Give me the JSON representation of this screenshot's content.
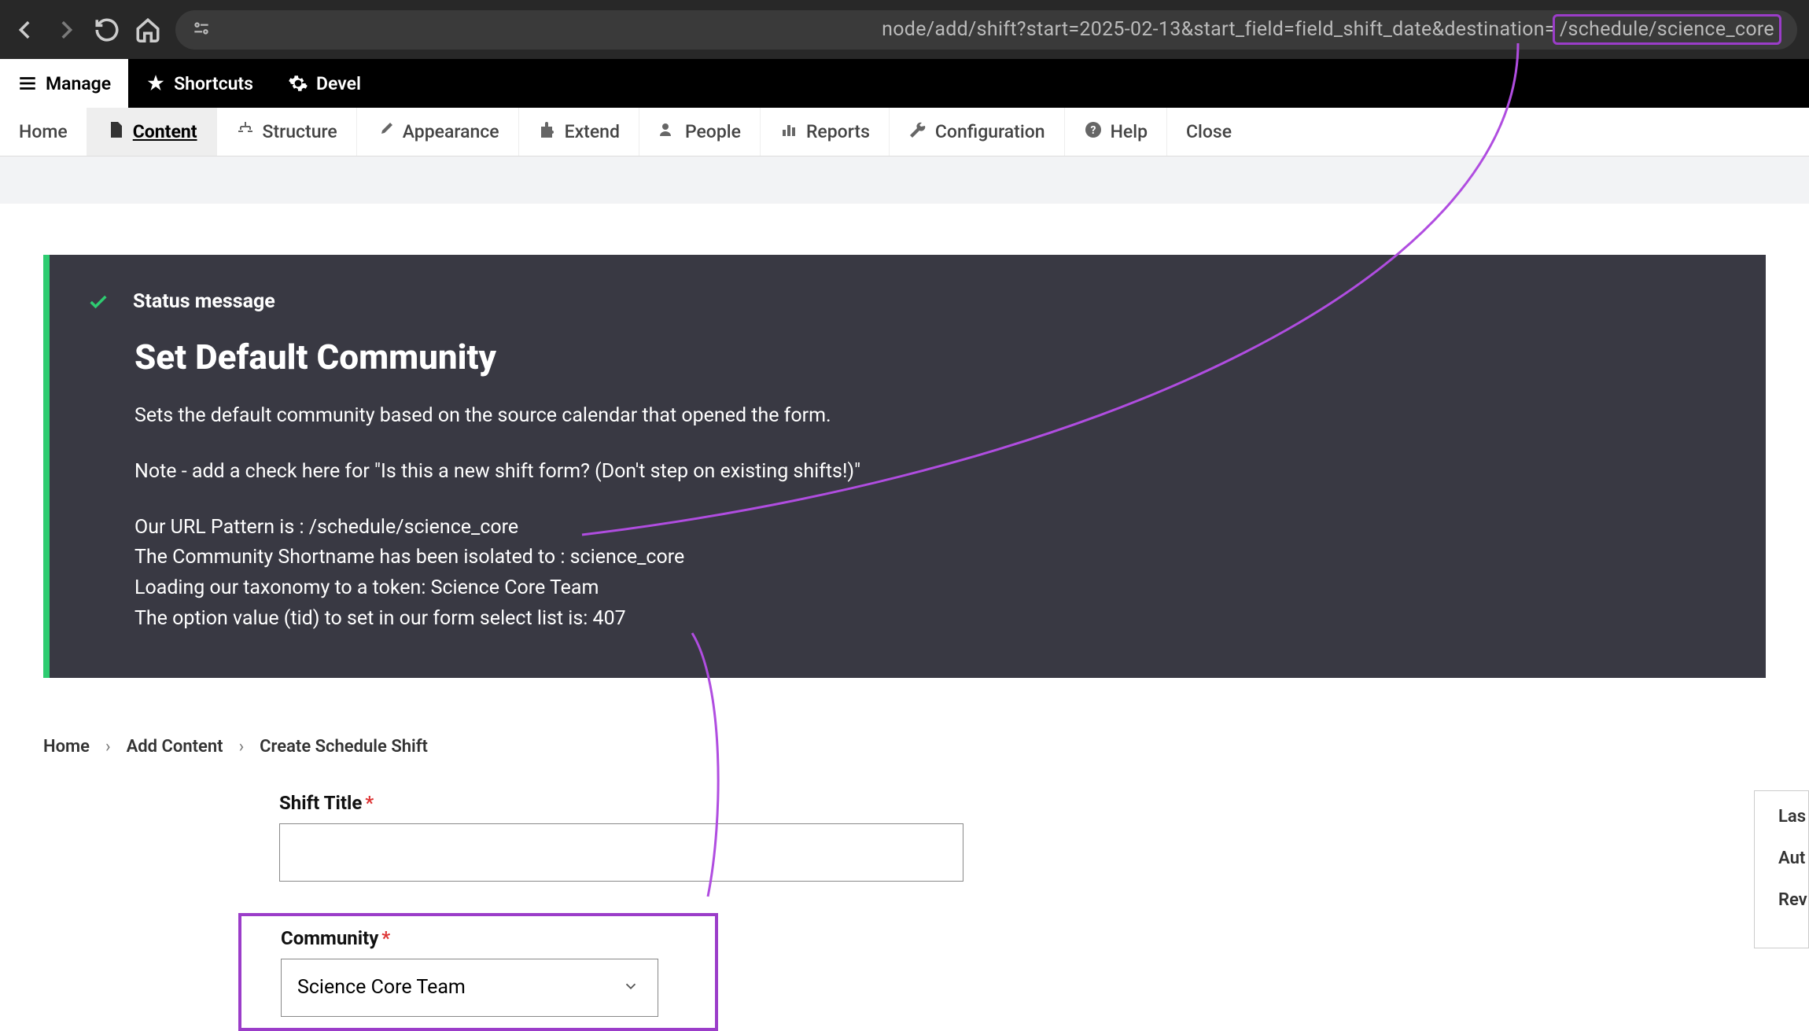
{
  "browser": {
    "url_main": "node/add/shift?start=2025-02-13&start_field=field_shift_date&destination=",
    "url_highlighted": "/schedule/science_core"
  },
  "toolbar_black": {
    "manage": "Manage",
    "shortcuts": "Shortcuts",
    "devel": "Devel"
  },
  "admin_menu": {
    "home": "Home",
    "content": "Content",
    "structure": "Structure",
    "appearance": "Appearance",
    "extend": "Extend",
    "people": "People",
    "reports": "Reports",
    "configuration": "Configuration",
    "help": "Help",
    "close": "Close"
  },
  "status": {
    "label": "Status message",
    "title": "Set Default Community",
    "line1": "Sets the default community based on the source calendar that opened the form.",
    "line2": "Note - add a check here for \"Is this a new shift form? (Don't step on existing shifts!)\"",
    "line3": "Our URL Pattern is : /schedule/science_core",
    "line4": "The Community Shortname has been isolated to : science_core",
    "line5": "Loading our taxonomy to a token: Science Core Team",
    "line6": "The option value (tid) to set in our form select list is: 407"
  },
  "breadcrumb": {
    "home": "Home",
    "add_content": "Add Content",
    "create_shift": "Create Schedule Shift"
  },
  "form": {
    "shift_title_label": "Shift Title",
    "shift_title_value": "",
    "community_label": "Community",
    "community_value": "Science Core Team"
  },
  "side_panel": {
    "item1": "Las",
    "item2": "Aut",
    "item3": "Rev"
  }
}
